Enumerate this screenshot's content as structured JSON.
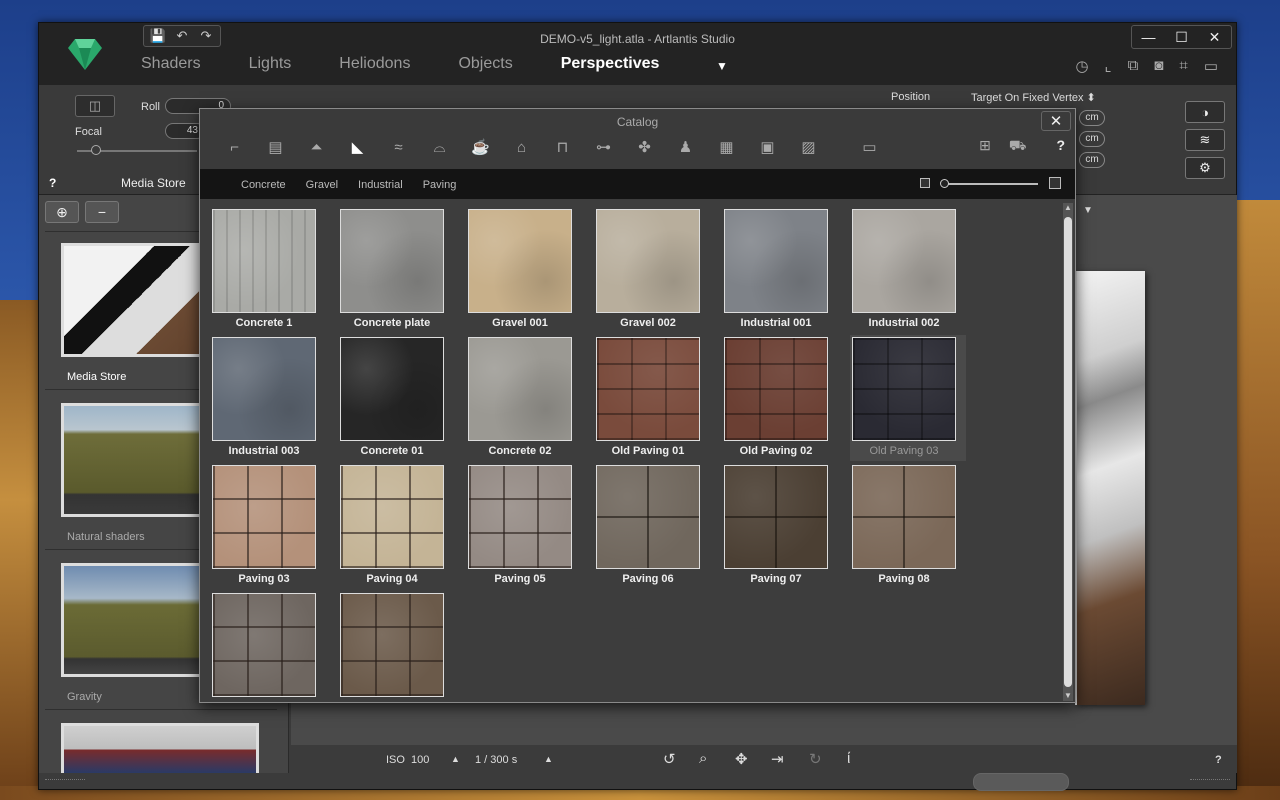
{
  "window": {
    "title": "DEMO-v5_light.atla - Artlantis Studio",
    "controls": [
      "—",
      "☐",
      "✕"
    ]
  },
  "quick_access": [
    "💾",
    "↶",
    "↷"
  ],
  "tabs": [
    {
      "label": "Shaders",
      "active": false
    },
    {
      "label": "Lights",
      "active": false
    },
    {
      "label": "Heliodons",
      "active": false
    },
    {
      "label": "Objects",
      "active": false
    },
    {
      "label": "Perspectives",
      "active": true
    }
  ],
  "tab_caret": "▼",
  "toolbar": {
    "roll_label": "Roll",
    "roll_value": "0",
    "focal_label": "Focal",
    "focal_value": "43",
    "position_label": "Position",
    "target_label": "Target On Fixed Vertex",
    "unit": "cm"
  },
  "media_header": {
    "help": "?",
    "title": "Media Store"
  },
  "left_panel": {
    "items": [
      {
        "label": "Media Store"
      },
      {
        "label": "Natural shaders"
      },
      {
        "label": "Gravity"
      }
    ]
  },
  "statusbar": {
    "iso_label": "ISO",
    "iso_value": "100",
    "shutter": "1 /  300 s",
    "help": "?"
  },
  "catalog": {
    "title": "Catalog",
    "close": "✕",
    "help": "?",
    "subcategories": [
      "Concrete",
      "Gravel",
      "Industrial",
      "Paving"
    ],
    "items": [
      {
        "name": "Concrete 1",
        "color": "#a9aaa6",
        "tex": "stripes"
      },
      {
        "name": "Concrete plate",
        "color": "#8e8e8c",
        "tex": "noise"
      },
      {
        "name": "Gravel 001",
        "color": "#c8b08a",
        "tex": "noise"
      },
      {
        "name": "Gravel 002",
        "color": "#b8ae9c",
        "tex": "noise"
      },
      {
        "name": "Industrial 001",
        "color": "#7e8288",
        "tex": "noise"
      },
      {
        "name": "Industrial 002",
        "color": "#aaa6a0",
        "tex": "noise"
      },
      {
        "name": "Industrial 003",
        "color": "#5f6874",
        "tex": "noise"
      },
      {
        "name": "Concrete 01",
        "color": "#262626",
        "tex": "noise"
      },
      {
        "name": "Concrete 02",
        "color": "#9b9993",
        "tex": "noise"
      },
      {
        "name": "Old Paving 01",
        "color": "#7a4b3c",
        "tex": "bricks"
      },
      {
        "name": "Old Paving 02",
        "color": "#6b3f33",
        "tex": "bricks"
      },
      {
        "name": "Old Paving 03",
        "color": "#2a2a33",
        "tex": "bricks",
        "selected": true
      },
      {
        "name": "Paving 03",
        "color": "#b4917a",
        "tex": "tiles"
      },
      {
        "name": "Paving 04",
        "color": "#c4b496",
        "tex": "tiles"
      },
      {
        "name": "Paving 05",
        "color": "#948a84",
        "tex": "tiles"
      },
      {
        "name": "Paving 06",
        "color": "#70675d",
        "tex": "tiles4"
      },
      {
        "name": "Paving 07",
        "color": "#4b3f33",
        "tex": "tiles4"
      },
      {
        "name": "Paving 08",
        "color": "#7b6858",
        "tex": "tiles4"
      },
      {
        "name": "",
        "color": "#6e6660",
        "tex": "tiles"
      },
      {
        "name": "",
        "color": "#6b5a4a",
        "tex": "tiles"
      }
    ]
  }
}
